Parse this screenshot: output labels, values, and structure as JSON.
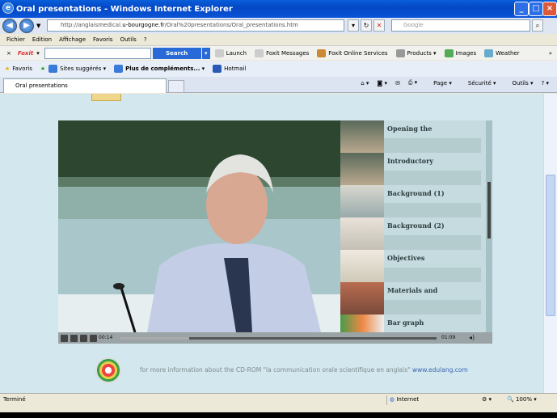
{
  "window": {
    "title": "Oral presentations - Windows Internet Explorer"
  },
  "address": {
    "prefix": "http://anglaismedical.",
    "domain": "u-bourgogne.fr",
    "path": "/Oral%20presentations/Oral_presentations.htm"
  },
  "search": {
    "placeholder": "Google"
  },
  "menu": [
    "Fichier",
    "Edition",
    "Affichage",
    "Favoris",
    "Outils",
    "?"
  ],
  "foxit": {
    "brand": "Foxit",
    "search_label": "Search",
    "items": [
      "Launch",
      "Foxit Messages",
      "Foxit Online Services",
      "Products",
      "Images",
      "Weather"
    ]
  },
  "favbar": {
    "favoris": "Favoris",
    "items": [
      "Sites suggérés",
      "Plus de compléments...",
      "Hotmail"
    ]
  },
  "tab": {
    "title": "Oral presentations"
  },
  "tools": [
    "Page",
    "Sécurité",
    "Outils"
  ],
  "player": {
    "chapters": [
      "Opening the",
      "Introductory",
      "Background (1)",
      "Background (2)",
      "Objectives",
      "Materials and",
      "Bar graph"
    ],
    "time_elapsed": "00:14",
    "time_total": "01:09",
    "progress": 0.22
  },
  "footer": {
    "text": "for more information about the CD-ROM \"la communication orale scientifique en anglais\"",
    "link": "www.edulang.com"
  },
  "status": {
    "left": "Terminé",
    "zone": "Internet",
    "zoom": "100%"
  }
}
